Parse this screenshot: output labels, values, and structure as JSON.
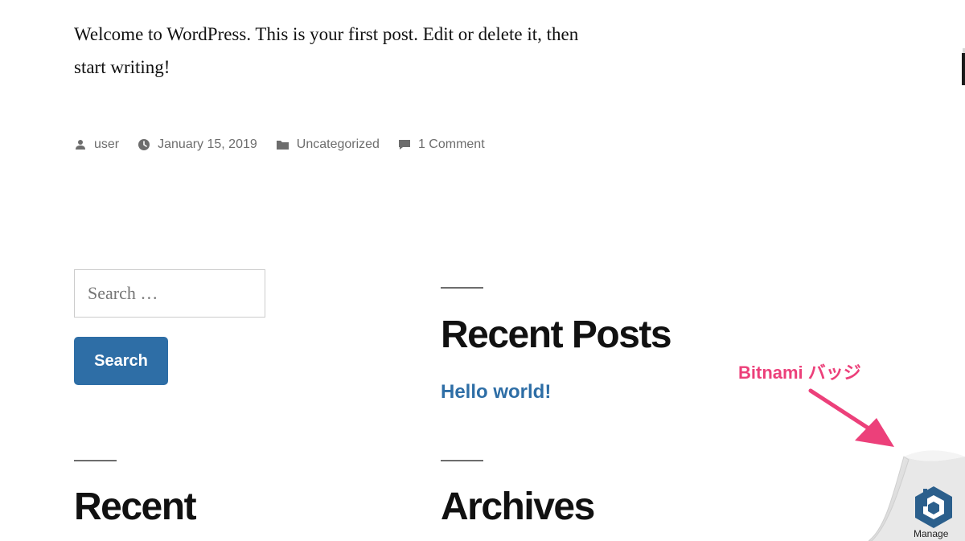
{
  "post": {
    "content": "Welcome to WordPress. This is your first post. Edit or delete it, then start writing!"
  },
  "meta": {
    "author": "user",
    "date": "January 15, 2019",
    "category": "Uncategorized",
    "comments": "1 Comment",
    "icons": [
      "person-icon",
      "clock-icon",
      "folder-icon",
      "comment-icon"
    ]
  },
  "search": {
    "placeholder": "Search …",
    "button_label": "Search"
  },
  "widgets": {
    "recent_posts_title": "Recent Posts",
    "recent_posts_items": [
      "Hello world!"
    ],
    "recent_title": "Recent",
    "archives_title": "Archives"
  },
  "annotation": {
    "label": "Bitnami バッジ",
    "color": "#ec407a"
  },
  "badge": {
    "label": "Manage",
    "icon": "bitnami-logo-icon",
    "color": "#2b5f8c"
  },
  "colors": {
    "link": "#2e6ea6",
    "button": "#2e6ea6",
    "meta_text": "#6d6d6d",
    "heading": "#111111"
  }
}
